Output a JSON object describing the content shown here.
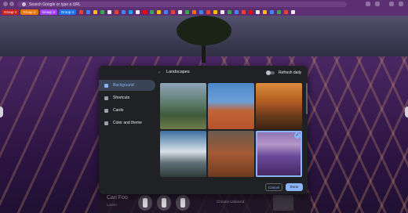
{
  "browser": {
    "omnibox_placeholder": "Search Google or type a URL",
    "tab_groups": [
      {
        "label": "Group 1",
        "color": "#c5221f"
      },
      {
        "label": "Group 2",
        "color": "#e8710a"
      },
      {
        "label": "Group 3",
        "color": "#a142f4"
      },
      {
        "label": "Group 4",
        "color": "#1a73e8"
      }
    ]
  },
  "dialog": {
    "title": "Landscapes",
    "refresh_label": "Refresh daily",
    "menu": [
      {
        "label": "Background",
        "icon": "image-icon",
        "active": true
      },
      {
        "label": "Shortcuts",
        "icon": "link-icon"
      },
      {
        "label": "Cards",
        "icon": "cards-icon"
      },
      {
        "label": "Color and theme",
        "icon": "palette-icon"
      }
    ],
    "cancel_label": "Cancel",
    "done_label": "Done",
    "selected_tile": 6,
    "accent": "#8ab4f8"
  },
  "ntp": {
    "name": "Cari Foo",
    "sub": "Lorem",
    "link": "Chrome Unboxed"
  }
}
